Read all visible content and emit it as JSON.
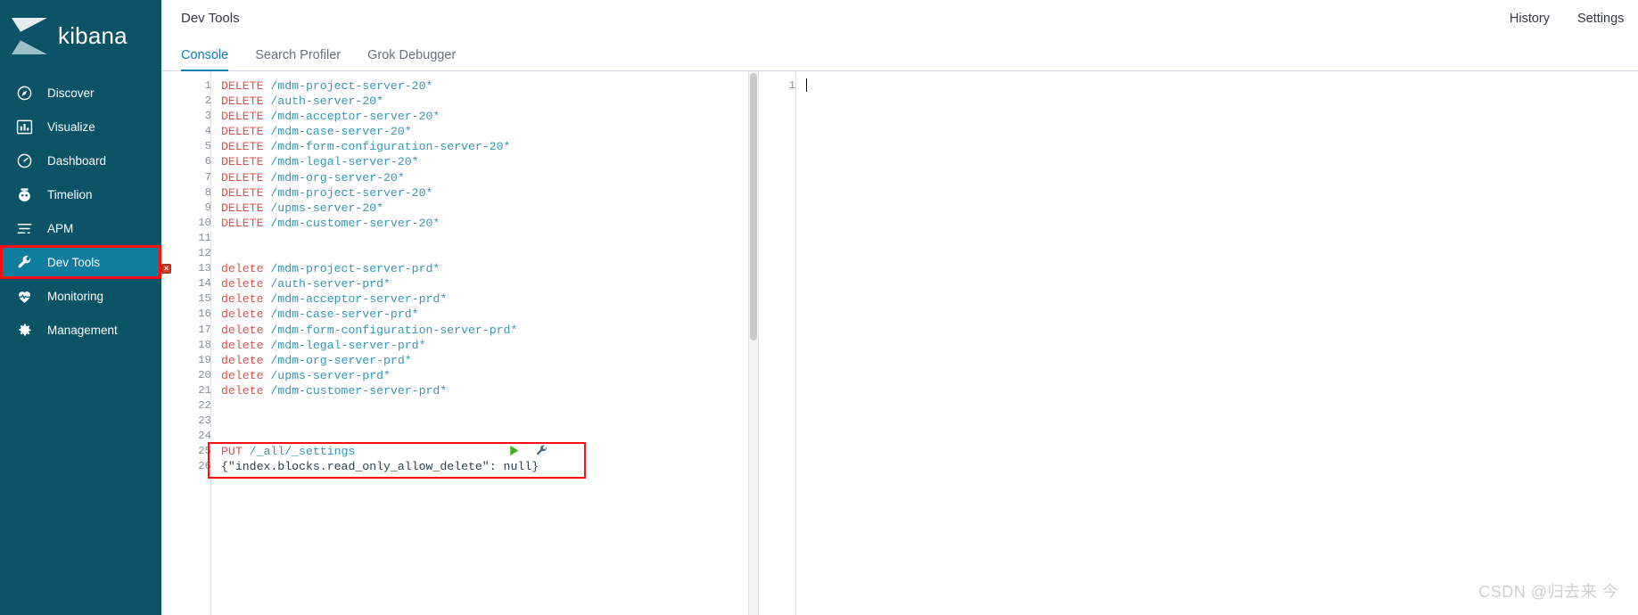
{
  "sidebar": {
    "brand": {
      "name": "kibana",
      "logo_icon": "kibana-logo-icon"
    },
    "items": [
      {
        "label": "Discover",
        "icon": "compass-icon",
        "selected": false
      },
      {
        "label": "Visualize",
        "icon": "bar-chart-icon",
        "selected": false
      },
      {
        "label": "Dashboard",
        "icon": "dashboard-gauge-icon",
        "selected": false
      },
      {
        "label": "Timelion",
        "icon": "timelion-clock-icon",
        "selected": false
      },
      {
        "label": "APM",
        "icon": "apm-lines-icon",
        "selected": false
      },
      {
        "label": "Dev Tools",
        "icon": "wrench-icon",
        "selected": true
      },
      {
        "label": "Monitoring",
        "icon": "heartbeat-icon",
        "selected": false
      },
      {
        "label": "Management",
        "icon": "gear-icon",
        "selected": false
      }
    ]
  },
  "header": {
    "title": "Dev Tools",
    "links": [
      {
        "label": "History"
      },
      {
        "label": "Settings"
      }
    ]
  },
  "tabs": [
    {
      "label": "Console",
      "active": true
    },
    {
      "label": "Search Profiler",
      "active": false
    },
    {
      "label": "Grok Debugger",
      "active": false
    }
  ],
  "colors": {
    "sidebar_bg": "#0b5367",
    "sidebar_selected_bg": "#0f7ca0",
    "accent_tab": "#0a7fb5",
    "highlight_border": "#ff0d0d",
    "method_token": "#d9534f",
    "url_token": "#3596b5",
    "error_badge": "#cc3b28",
    "play_green": "#3cb521"
  },
  "editor": {
    "request_lines": [
      {
        "num": 1,
        "method": "DELETE",
        "url": " /mdm-project-server-20*",
        "error": false
      },
      {
        "num": 2,
        "method": "DELETE",
        "url": " /auth-server-20*",
        "error": false
      },
      {
        "num": 3,
        "method": "DELETE",
        "url": " /mdm-acceptor-server-20*",
        "error": false
      },
      {
        "num": 4,
        "method": "DELETE",
        "url": " /mdm-case-server-20*",
        "error": false
      },
      {
        "num": 5,
        "method": "DELETE",
        "url": " /mdm-form-configuration-server-20*",
        "error": false
      },
      {
        "num": 6,
        "method": "DELETE",
        "url": " /mdm-legal-server-20*",
        "error": false
      },
      {
        "num": 7,
        "method": "DELETE",
        "url": " /mdm-org-server-20*",
        "error": false
      },
      {
        "num": 8,
        "method": "DELETE",
        "url": " /mdm-project-server-20*",
        "error": false
      },
      {
        "num": 9,
        "method": "DELETE",
        "url": " /upms-server-20*",
        "error": false
      },
      {
        "num": 10,
        "method": "DELETE",
        "url": " /mdm-customer-server-20*",
        "error": false
      },
      {
        "num": 11,
        "method": "",
        "url": "",
        "error": false
      },
      {
        "num": 12,
        "method": "",
        "url": "",
        "error": false
      },
      {
        "num": 13,
        "method": "delete",
        "url": " /mdm-project-server-prd*",
        "error": true
      },
      {
        "num": 14,
        "method": "delete",
        "url": " /auth-server-prd*",
        "error": false
      },
      {
        "num": 15,
        "method": "delete",
        "url": " /mdm-acceptor-server-prd*",
        "error": false
      },
      {
        "num": 16,
        "method": "delete",
        "url": " /mdm-case-server-prd*",
        "error": false
      },
      {
        "num": 17,
        "method": "delete",
        "url": " /mdm-form-configuration-server-prd*",
        "error": false
      },
      {
        "num": 18,
        "method": "delete",
        "url": " /mdm-legal-server-prd*",
        "error": false
      },
      {
        "num": 19,
        "method": "delete",
        "url": " /mdm-org-server-prd*",
        "error": false
      },
      {
        "num": 20,
        "method": "delete",
        "url": " /upms-server-prd*",
        "error": false
      },
      {
        "num": 21,
        "method": "delete",
        "url": " /mdm-customer-server-prd*",
        "error": false
      },
      {
        "num": 22,
        "method": "",
        "url": "",
        "error": false
      },
      {
        "num": 23,
        "method": "",
        "url": "",
        "error": false
      },
      {
        "num": 24,
        "method": "",
        "url": "",
        "error": false
      },
      {
        "num": 25,
        "method": "PUT",
        "url": " /_all/_settings",
        "error": false,
        "highlighted": true
      },
      {
        "num": 26,
        "method": "",
        "body": "{\"index.blocks.read_only_allow_delete\": null}",
        "url": "",
        "error": false,
        "highlighted": true
      }
    ],
    "error_badge_glyph": "×",
    "actions": {
      "play_label": "play-request",
      "wrench_label": "request-options"
    }
  },
  "response": {
    "lines": [
      {
        "num": 1,
        "text": ""
      }
    ]
  },
  "watermark": {
    "text": "CSDN @归去来 今"
  }
}
